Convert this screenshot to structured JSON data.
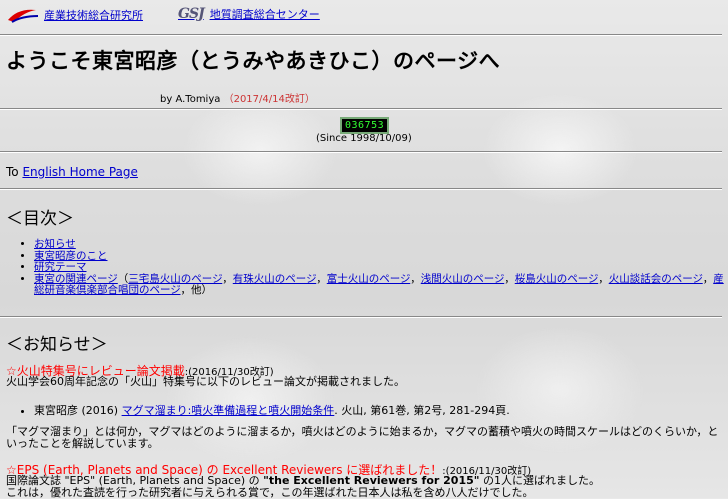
{
  "header": {
    "aist_label": "産業技術総合研究所",
    "gsj_mark": "GSJ",
    "gsj_label": "地質調査総合センター"
  },
  "title": "ようこそ東宮昭彦（とうみやあきひこ）のページへ",
  "byline": {
    "author": "by A.Tomiya",
    "date": "（2017/4/14改訂）"
  },
  "counter": {
    "value": "036753",
    "since": "(Since 1998/10/09)"
  },
  "english": {
    "prefix": "To ",
    "link": "English Home Page"
  },
  "toc": {
    "heading": "＜目次＞",
    "items": [
      {
        "label": "お知らせ"
      },
      {
        "label": "東宮昭彦のこと"
      },
      {
        "label": "研究テーマ"
      }
    ],
    "related": {
      "label": "東宮の関連ページ",
      "open": "（",
      "links": [
        "三宅島火山のページ",
        "有珠火山のページ",
        "富士火山のページ",
        "浅間火山のページ",
        "桜島火山のページ",
        "火山談話会のページ",
        "産総研音楽倶楽部合唱団のページ"
      ],
      "sep": "，",
      "tail": "，他）"
    }
  },
  "news": {
    "heading": "＜お知らせ＞",
    "item1": {
      "star": "☆",
      "title": "火山特集号にレビュー論文掲載",
      "date": ":(2016/11/30改訂)",
      "intro": "火山学会60周年記念の「火山」特集号に以下のレビュー論文が掲載されました。",
      "ref_author": "東宮昭彦 (2016) ",
      "ref_link": "マグマ溜まり:噴火準備過程と噴火開始条件",
      "ref_tail": ". 火山, 第61巻, 第2号, 281-294頁.",
      "body": "「マグマ溜まり」とは何か，マグマはどのように溜まるか，噴火はどのように始まるか，マグマの蓄積や噴火の時間スケールはどのくらいか，といったことを解説しています。"
    },
    "item2": {
      "star": "☆",
      "title": "EPS (Earth, Planets and Space) の Excellent Reviewers に選ばれました！",
      "date": ":(2016/11/30改訂)",
      "line1a": "国際論文誌 \"EPS\" (Earth, Planets and Space) の ",
      "line1b": "\"the Excellent Reviewers for 2015\"",
      "line1c": " の1人に選ばれました。",
      "line2": "これは，優れた査読を行った研究者に与えられる賞で，この年選ばれた日本人は私を含め八人だけでした。"
    }
  }
}
